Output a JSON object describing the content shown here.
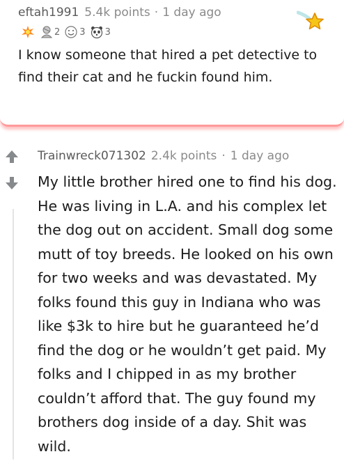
{
  "parent": {
    "username": "eftah1991",
    "points": "5.4k points",
    "separator": "·",
    "age": "1 day ago",
    "awards": [
      {
        "icon": "burst-award-icon",
        "count": ""
      },
      {
        "icon": "bust-award-icon",
        "count": "2"
      },
      {
        "icon": "face-award-icon",
        "count": "3"
      },
      {
        "icon": "panda-award-icon",
        "count": "3"
      }
    ],
    "body": "I know someone that hired a pet detective to find their cat and he fuckin found him.",
    "favorite_icon": "shooting-star-icon"
  },
  "reply": {
    "username": "Trainwreck071302",
    "points": "2.4k points",
    "separator": "·",
    "age": "1 day ago",
    "upvote_icon": "upvote-arrow-icon",
    "downvote_icon": "downvote-arrow-icon",
    "body": "My little brother hired one to find his dog. He was living in L.A. and his complex let the dog out on accident. Small dog some mutt of toy breeds. He looked on his own for two weeks and was devastated. My folks found this guy in Indiana who was like $3k to hire but he guaranteed he’d find the dog or he wouldn’t get paid. My folks and I chipped in as my brother couldn’t afford that. The guy found my brothers dog inside of a day. Shit was wild."
  },
  "colors": {
    "highlight_border": "#ff9a9a",
    "vote_arrow": "#878a8c",
    "star": "#f5c518"
  }
}
